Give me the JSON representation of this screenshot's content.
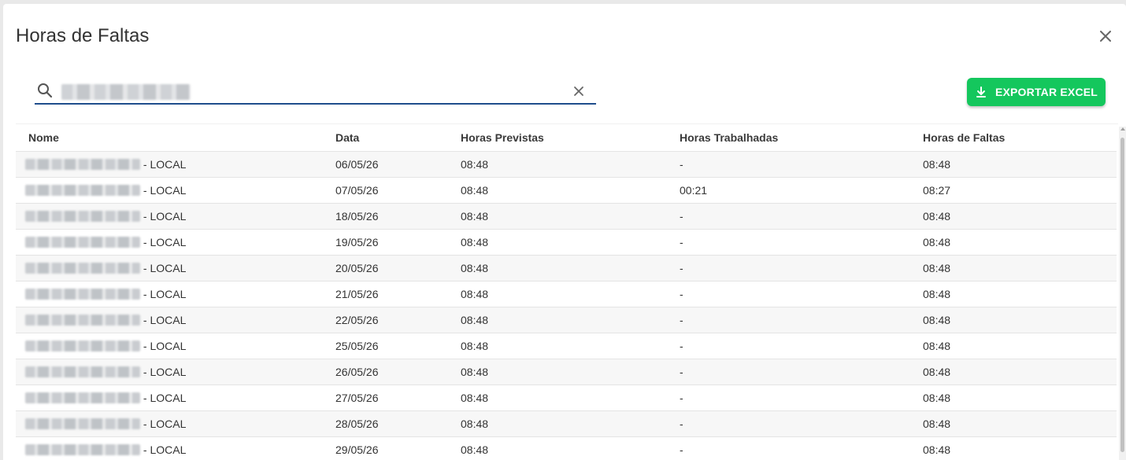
{
  "dialog": {
    "title": "Horas de Faltas",
    "close_icon": "close-icon"
  },
  "search": {
    "icon": "search-icon",
    "value": "",
    "clear_icon": "clear-icon"
  },
  "export_button": {
    "label": "EXPORTAR EXCEL",
    "icon": "download-icon",
    "color": "#14c75d"
  },
  "accent_color": "#1f4e8c",
  "table": {
    "headers": [
      "Nome",
      "Data",
      "Horas Previstas",
      "Horas Trabalhadas",
      "Horas de Faltas"
    ],
    "rows": [
      {
        "nome_suffix": " - LOCAL",
        "data": "06/05/26",
        "previstas": "08:48",
        "trabalhadas": "-",
        "faltas": "08:48"
      },
      {
        "nome_suffix": " - LOCAL",
        "data": "07/05/26",
        "previstas": "08:48",
        "trabalhadas": "00:21",
        "faltas": "08:27"
      },
      {
        "nome_suffix": " - LOCAL",
        "data": "18/05/26",
        "previstas": "08:48",
        "trabalhadas": "-",
        "faltas": "08:48"
      },
      {
        "nome_suffix": " - LOCAL",
        "data": "19/05/26",
        "previstas": "08:48",
        "trabalhadas": "-",
        "faltas": "08:48"
      },
      {
        "nome_suffix": " - LOCAL",
        "data": "20/05/26",
        "previstas": "08:48",
        "trabalhadas": "-",
        "faltas": "08:48"
      },
      {
        "nome_suffix": " - LOCAL",
        "data": "21/05/26",
        "previstas": "08:48",
        "trabalhadas": "-",
        "faltas": "08:48"
      },
      {
        "nome_suffix": " - LOCAL",
        "data": "22/05/26",
        "previstas": "08:48",
        "trabalhadas": "-",
        "faltas": "08:48"
      },
      {
        "nome_suffix": " - LOCAL",
        "data": "25/05/26",
        "previstas": "08:48",
        "trabalhadas": "-",
        "faltas": "08:48"
      },
      {
        "nome_suffix": " - LOCAL",
        "data": "26/05/26",
        "previstas": "08:48",
        "trabalhadas": "-",
        "faltas": "08:48"
      },
      {
        "nome_suffix": " - LOCAL",
        "data": "27/05/26",
        "previstas": "08:48",
        "trabalhadas": "-",
        "faltas": "08:48"
      },
      {
        "nome_suffix": " - LOCAL",
        "data": "28/05/26",
        "previstas": "08:48",
        "trabalhadas": "-",
        "faltas": "08:48"
      },
      {
        "nome_suffix": " - LOCAL",
        "data": "29/05/26",
        "previstas": "08:48",
        "trabalhadas": "-",
        "faltas": "08:48"
      }
    ]
  }
}
